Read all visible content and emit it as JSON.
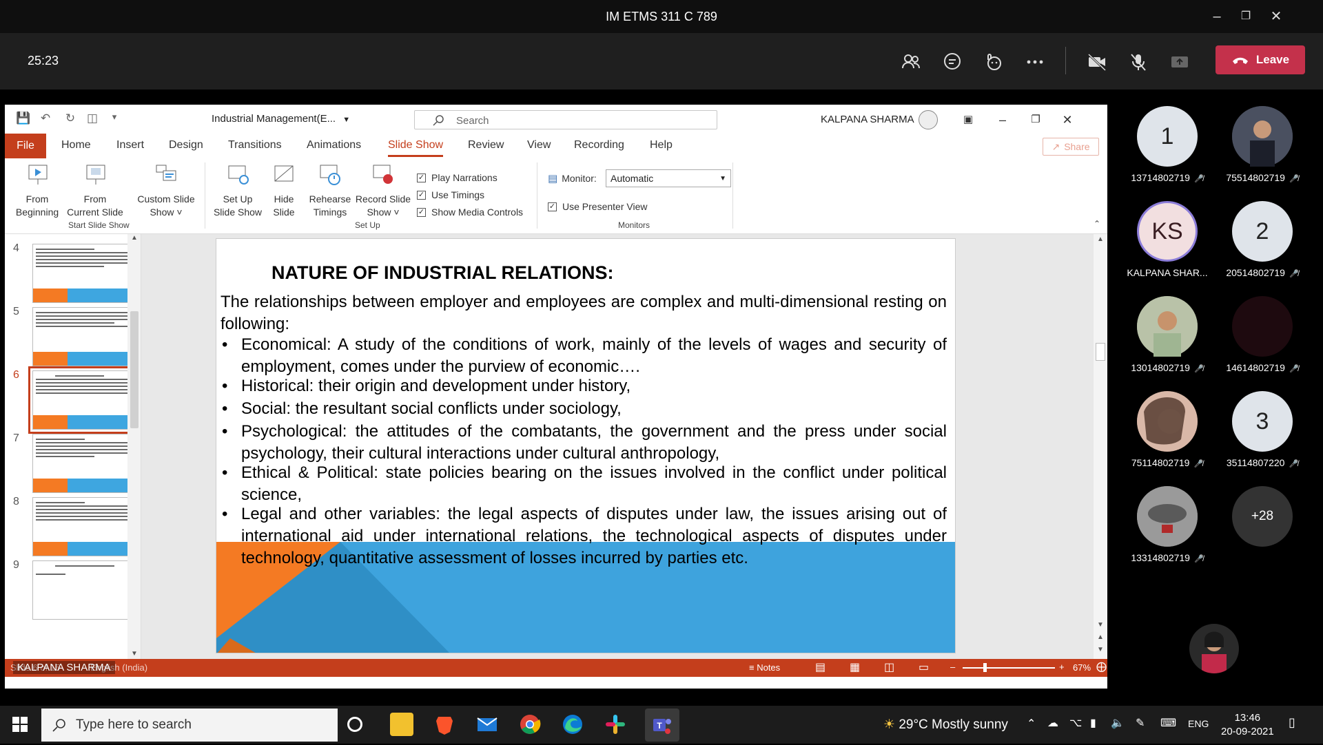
{
  "teams": {
    "window_title": "IM ETMS 311 C 789",
    "timer": "25:23",
    "leave_label": "Leave"
  },
  "powerpoint": {
    "doc_title": "Industrial Management(E...",
    "search_placeholder": "Search",
    "user_name": "KALPANA SHARMA",
    "share_label": "Share",
    "tabs": [
      "File",
      "Home",
      "Insert",
      "Design",
      "Transitions",
      "Animations",
      "Slide Show",
      "Review",
      "View",
      "Recording",
      "Help"
    ],
    "ribbon": {
      "from_beginning": [
        "From",
        "Beginning"
      ],
      "from_current": [
        "From",
        "Current Slide"
      ],
      "custom_show": [
        "Custom Slide",
        "Show ˅"
      ],
      "setup_show": [
        "Set Up",
        "Slide Show"
      ],
      "hide_slide": [
        "Hide",
        "Slide"
      ],
      "rehearse": [
        "Rehearse",
        "Timings"
      ],
      "record": [
        "Record Slide",
        "Show ˅"
      ],
      "play_narrations": "Play Narrations",
      "use_timings": "Use Timings",
      "show_media": "Show Media Controls",
      "monitor_label": "Monitor:",
      "monitor_value": "Automatic",
      "presenter_view": "Use Presenter View",
      "group_start": "Start Slide Show",
      "group_setup": "Set Up",
      "group_monitors": "Monitors"
    },
    "thumbnails": [
      "4",
      "5",
      "6",
      "7",
      "8",
      "9"
    ],
    "selected_slide": "6",
    "status": {
      "slide_info": "Slide 6 of 15",
      "language": "English (India)",
      "notes": "Notes",
      "zoom": "67%"
    }
  },
  "slide": {
    "title": "NATURE OF INDUSTRIAL RELATIONS:",
    "intro": "The relationships between employer and employees are complex and multi-dimensional resting on following:",
    "bullets": [
      "Economical: A study of the conditions of work, mainly of the levels of wages and security of employment, comes under the purview of economic….",
      "Historical: their origin and development under history,",
      "Social: the resultant social conflicts under sociology,",
      "Psychological: the attitudes of the combatants, the government and the press under social psychology, their cultural interactions under cultural anthropology,",
      "Ethical & Political: state policies bearing on the issues involved in the conflict under political science,",
      "Legal and other variables: the legal aspects of disputes under law, the issues arising out of international aid under international relations, the technological aspects of disputes under technology, quantitative assessment of losses incurred by parties etc."
    ]
  },
  "presenter_label": "KALPANA SHARMA",
  "participants": [
    {
      "initials": "1",
      "name": "13714802719"
    },
    {
      "initials": "",
      "name": "75514802719"
    },
    {
      "initials": "KS",
      "name": "KALPANA SHAR..."
    },
    {
      "initials": "2",
      "name": "20514802719"
    },
    {
      "initials": "",
      "name": "13014802719"
    },
    {
      "initials": "",
      "name": "14614802719"
    },
    {
      "initials": "",
      "name": "75114802719"
    },
    {
      "initials": "3",
      "name": "35114807220"
    },
    {
      "initials": "",
      "name": "13314802719"
    },
    {
      "initials": "+28",
      "name": ""
    }
  ],
  "taskbar": {
    "search_placeholder": "Type here to search",
    "weather": "29°C  Mostly sunny",
    "lang": "ENG",
    "time": "13:46",
    "date": "20-09-2021"
  }
}
